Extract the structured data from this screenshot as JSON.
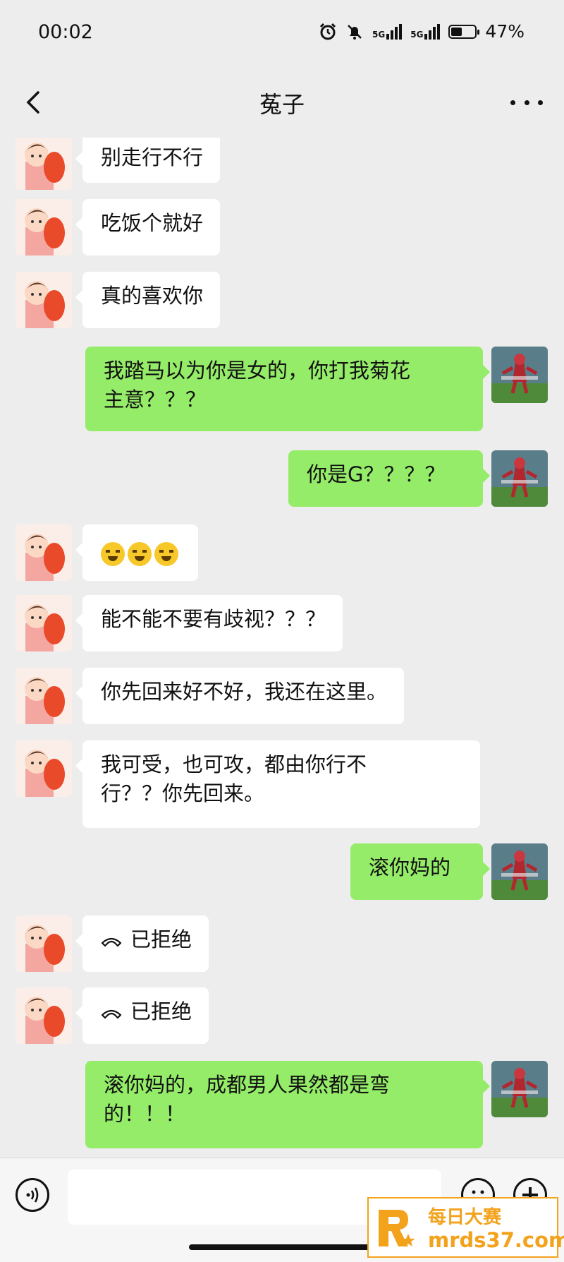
{
  "status_bar": {
    "time": "00:02",
    "network_1": "5G",
    "network_2": "5G",
    "battery_level": 0.47,
    "battery_text": "47%"
  },
  "nav": {
    "title": "菟子",
    "back_icon": "chevron-left-icon",
    "more_icon": "more-dots-icon"
  },
  "messages": [
    {
      "side": "in",
      "type": "text",
      "text": "别走行不行"
    },
    {
      "side": "in",
      "type": "text",
      "text": "吃饭个就好"
    },
    {
      "side": "in",
      "type": "text",
      "text": "真的喜欢你"
    },
    {
      "side": "out",
      "type": "text",
      "line1": "我踏马以为你是女的，你打我菊花",
      "line2": "主意？？？"
    },
    {
      "side": "out",
      "type": "text",
      "text": "你是G？？？？"
    },
    {
      "side": "in",
      "type": "emoji",
      "emoji": "crying-face-emoji",
      "count": 3
    },
    {
      "side": "in",
      "type": "text",
      "text": "能不能不要有歧视？？？"
    },
    {
      "side": "in",
      "type": "text",
      "text": "你先回来好不好，我还在这里。"
    },
    {
      "side": "in",
      "type": "text",
      "line1": "我可受，也可攻，都由你行不",
      "line2": "行？？你先回来。"
    },
    {
      "side": "out",
      "type": "text",
      "text": "滚你妈的"
    },
    {
      "side": "in",
      "type": "call",
      "text": "已拒绝"
    },
    {
      "side": "in",
      "type": "call",
      "text": "已拒绝"
    },
    {
      "side": "out",
      "type": "text",
      "line1": "滚你妈的，成都男人果然都是弯",
      "line2": "的！！！"
    }
  ],
  "input_bar": {
    "placeholder": "",
    "voice_icon": "voice-icon",
    "emoji_icon": "emoji-icon",
    "plus_icon": "plus-icon"
  },
  "watermark": {
    "line1": "每日大赛",
    "line2": "mrds37.com"
  },
  "colors": {
    "background": "#ededed",
    "outgoing_bubble": "#95ec69",
    "incoming_bubble": "#ffffff",
    "watermark": "#f3a21b"
  }
}
